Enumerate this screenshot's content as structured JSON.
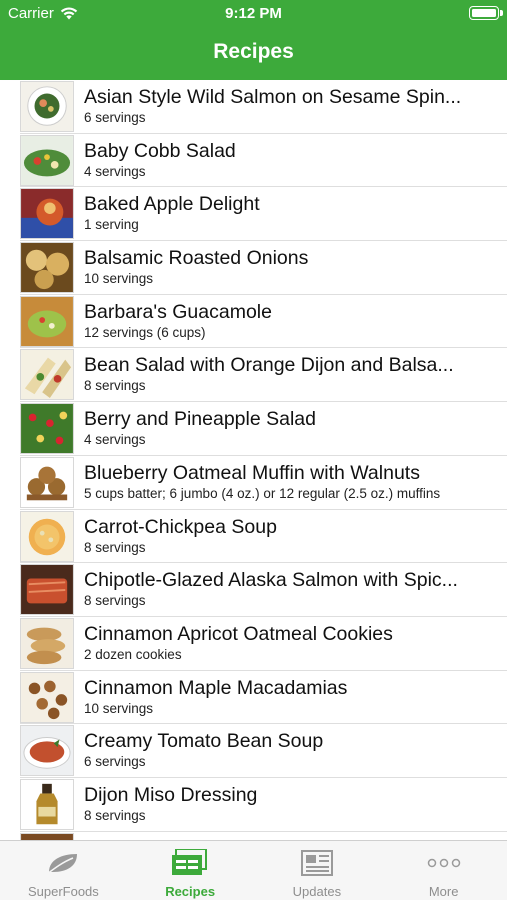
{
  "status_bar": {
    "carrier": "Carrier",
    "time": "9:12 PM"
  },
  "nav": {
    "title": "Recipes"
  },
  "recipes": [
    {
      "title": "Asian Style Wild Salmon on Sesame Spin...",
      "servings": "6 servings"
    },
    {
      "title": "Baby Cobb Salad",
      "servings": "4 servings"
    },
    {
      "title": "Baked Apple Delight",
      "servings": "1 serving"
    },
    {
      "title": "Balsamic Roasted Onions",
      "servings": "10 servings"
    },
    {
      "title": "Barbara's Guacamole",
      "servings": "12 servings (6 cups)"
    },
    {
      "title": "Bean Salad with Orange Dijon and Balsa...",
      "servings": "8 servings"
    },
    {
      "title": "Berry and Pineapple Salad",
      "servings": "4 servings"
    },
    {
      "title": "Blueberry Oatmeal Muffin with Walnuts",
      "servings": "5 cups batter; 6 jumbo (4 oz.) or 12 regular (2.5 oz.) muffins"
    },
    {
      "title": "Carrot-Chickpea Soup",
      "servings": "8 servings"
    },
    {
      "title": "Chipotle-Glazed Alaska Salmon with Spic...",
      "servings": "8 servings"
    },
    {
      "title": "Cinnamon Apricot Oatmeal Cookies",
      "servings": "2 dozen cookies"
    },
    {
      "title": "Cinnamon Maple Macadamias",
      "servings": "10 servings"
    },
    {
      "title": "Creamy Tomato Bean Soup",
      "servings": "6 servings"
    },
    {
      "title": "Dijon Miso Dressing",
      "servings": "8 servings"
    },
    {
      "title": "",
      "servings": ""
    }
  ],
  "tabs": [
    {
      "label": "SuperFoods",
      "icon": "leaf-icon",
      "active": false
    },
    {
      "label": "Recipes",
      "icon": "recipe-cards-icon",
      "active": true
    },
    {
      "label": "Updates",
      "icon": "newspaper-icon",
      "active": false
    },
    {
      "label": "More",
      "icon": "more-dots-icon",
      "active": false
    }
  ],
  "colors": {
    "accent": "#3daa3b",
    "tab_inactive": "#8e8e8e"
  }
}
